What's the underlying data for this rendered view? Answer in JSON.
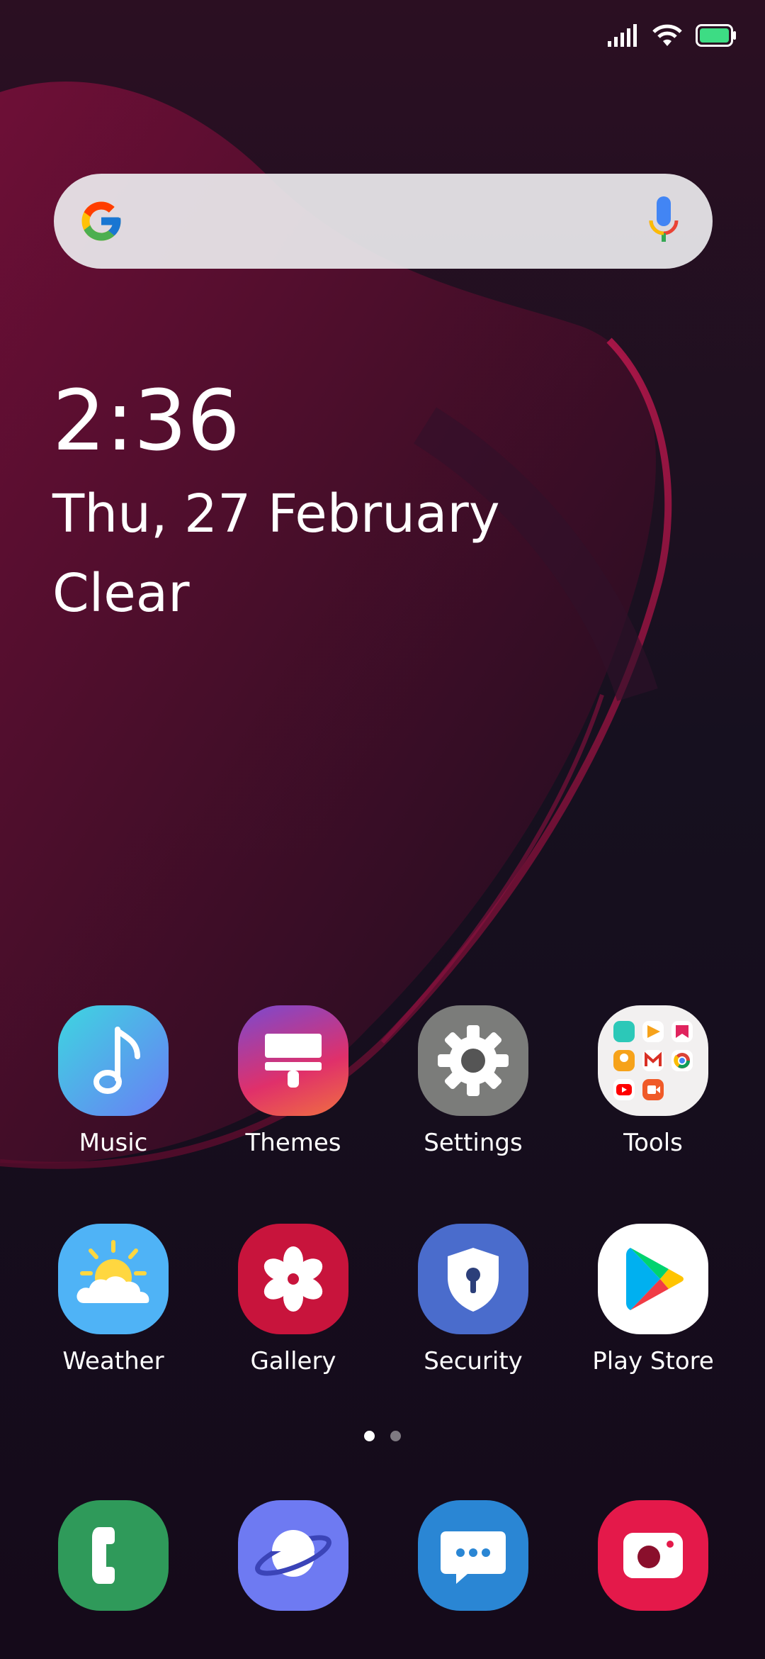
{
  "status_bar": {
    "signal_icon": "signal-icon",
    "wifi_icon": "wifi-icon",
    "battery_icon": "battery-icon",
    "battery_color": "#3ddc84"
  },
  "search": {
    "logo_icon": "google-g-icon",
    "mic_icon": "mic-icon"
  },
  "widget": {
    "time": "2:36",
    "date": "Thu, 27 February",
    "weather": "Clear"
  },
  "apps": [
    {
      "label": "Music",
      "icon": "music-note-icon"
    },
    {
      "label": "Themes",
      "icon": "paintbrush-icon"
    },
    {
      "label": "Settings",
      "icon": "gear-icon"
    },
    {
      "label": "Tools",
      "icon": "folder-icon"
    },
    {
      "label": "Weather",
      "icon": "sun-cloud-icon"
    },
    {
      "label": "Gallery",
      "icon": "flower-icon"
    },
    {
      "label": "Security",
      "icon": "shield-icon"
    },
    {
      "label": "Play Store",
      "icon": "play-store-icon"
    }
  ],
  "pages": {
    "count": 2,
    "current": 1
  },
  "dock": [
    {
      "name": "phone",
      "icon": "phone-icon",
      "color": "#2f9a5a"
    },
    {
      "name": "browser",
      "icon": "planet-icon",
      "color": "#6e7af2"
    },
    {
      "name": "messages",
      "icon": "chat-bubble-icon",
      "color": "#2a86d4"
    },
    {
      "name": "camera",
      "icon": "camera-icon",
      "color": "#e4194a"
    }
  ]
}
